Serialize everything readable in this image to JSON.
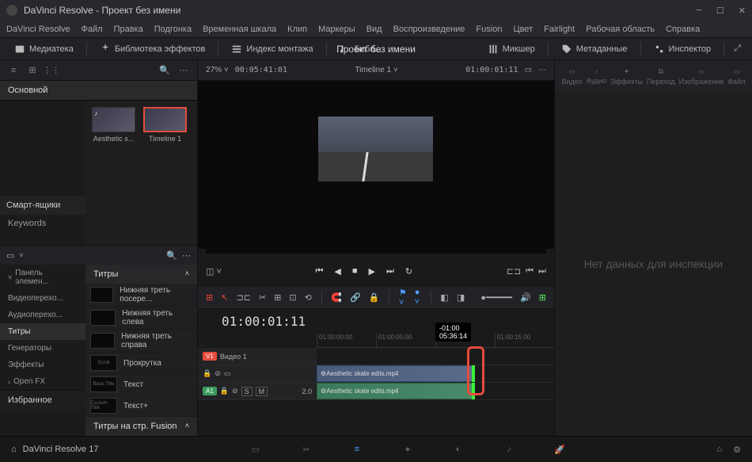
{
  "window": {
    "title": "DaVinci Resolve - Проект без имени"
  },
  "menubar": [
    "DaVinci Resolve",
    "Файл",
    "Правка",
    "Подгонка",
    "Временная шкала",
    "Клип",
    "Маркеры",
    "Вид",
    "Воспроизведение",
    "Fusion",
    "Цвет",
    "Fairlight",
    "Рабочая область",
    "Справка"
  ],
  "toolbar": {
    "mediateka": "Медиатека",
    "effects_lib": "Библиотека эффектов",
    "index": "Индекс монтажа",
    "sound_lib": "Библ...",
    "mixer": "Микшер",
    "metadata": "Метаданные",
    "inspector": "Инспектор",
    "project_title": "Проект без имени"
  },
  "viewer": {
    "zoom": "27%",
    "tc_left": "00:05:41:01",
    "timeline_name": "Timeline 1",
    "tc_right": "01:00:01:11"
  },
  "media": {
    "tab": "Основной",
    "smartbins": "Смарт-ящики",
    "keywords": "Keywords",
    "clips": [
      {
        "label": "Aesthetic s..."
      },
      {
        "label": "Timeline 1"
      }
    ]
  },
  "effects": {
    "nav_header": "Панель элемен...",
    "nav": [
      "Видеоперехо...",
      "Аудиоперехо...",
      "Титры",
      "Генераторы",
      "Эффекты"
    ],
    "openfx": "Open FX",
    "favorites": "Избранное",
    "header": "Титры",
    "items": [
      {
        "thumb": "",
        "name": "Нижняя треть посере..."
      },
      {
        "thumb": "",
        "name": "Нижняя треть слева"
      },
      {
        "thumb": "",
        "name": "Нижняя треть справа"
      },
      {
        "thumb": "Scroll",
        "name": "Прокрутка"
      },
      {
        "thumb": "Basic Title",
        "name": "Текст"
      },
      {
        "thumb": "Custom Title",
        "name": "Текст+"
      }
    ],
    "fusion_header": "Титры на стр. Fusion"
  },
  "inspector": {
    "tabs": [
      "Видео",
      "Аудио",
      "Эффекты",
      "Переход",
      "Изображение",
      "Файл"
    ],
    "empty": "Нет данных для инспекции"
  },
  "timeline": {
    "timecode": "01:00:01:11",
    "ticks": [
      "01:00:00:00",
      "01:00:05:00",
      "01:00:10:00",
      "01:00:15:00"
    ],
    "v1": {
      "badge": "V1",
      "name": "Видео 1",
      "clip": "Aesthetic skate edits.mp4"
    },
    "a1": {
      "badge": "A1",
      "vol": "2.0",
      "clip": "Aesthetic skate edits.mp4"
    },
    "trim_delta": "-01:00",
    "trim_tc": "05:36:14"
  },
  "bottom": {
    "app": "DaVinci Resolve 17"
  }
}
